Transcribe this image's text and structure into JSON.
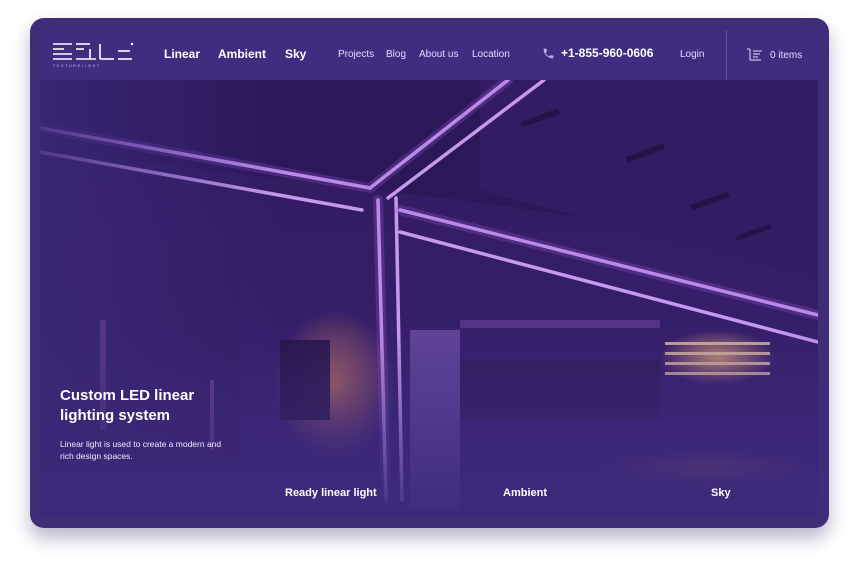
{
  "brand": {
    "logo_text": "TEXTURELIGHT"
  },
  "nav": {
    "main": [
      "Linear",
      "Ambient",
      "Sky"
    ],
    "secondary": [
      "Projects",
      "Blog",
      "About us",
      "Location"
    ],
    "phone": "+1-855-960-0606",
    "login": "Login",
    "cart": "0 items"
  },
  "hero": {
    "title": "Custom LED linear lighting system",
    "description": "Linear light is used to create a modern and rich design spaces."
  },
  "categories": [
    "Ready linear light",
    "Ambient",
    "Sky"
  ],
  "icons": [
    "logo-icon",
    "phone-icon",
    "cart-icon"
  ],
  "colors": {
    "nav_bg": "#3f2d80",
    "frame": "#3f2d78",
    "accent_light": "#d8a0ff",
    "warm_glow": "#f0a050"
  }
}
